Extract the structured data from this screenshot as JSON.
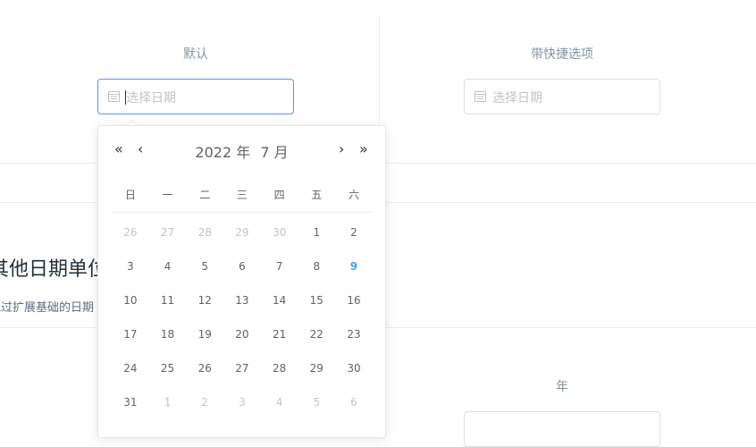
{
  "demos": {
    "default": {
      "label": "默认",
      "placeholder": "选择日期"
    },
    "shortcuts": {
      "label": "带快捷选项",
      "placeholder": "选择日期"
    },
    "year": {
      "label": "年"
    }
  },
  "section": {
    "title": "其他日期单位",
    "desc": "通过扩展基础的日期"
  },
  "picker": {
    "year_text": "2022 年",
    "month_text": "7 月",
    "nav": {
      "prev_year": "«",
      "prev_month": "‹",
      "next_month": "›",
      "next_year": "»"
    },
    "weekdays": [
      "日",
      "一",
      "二",
      "三",
      "四",
      "五",
      "六"
    ],
    "weeks": [
      [
        {
          "d": "26",
          "t": "other"
        },
        {
          "d": "27",
          "t": "other"
        },
        {
          "d": "28",
          "t": "other"
        },
        {
          "d": "29",
          "t": "other"
        },
        {
          "d": "30",
          "t": "other"
        },
        {
          "d": "1",
          "t": "cur"
        },
        {
          "d": "2",
          "t": "cur"
        }
      ],
      [
        {
          "d": "3",
          "t": "cur"
        },
        {
          "d": "4",
          "t": "cur"
        },
        {
          "d": "5",
          "t": "cur"
        },
        {
          "d": "6",
          "t": "cur"
        },
        {
          "d": "7",
          "t": "cur"
        },
        {
          "d": "8",
          "t": "cur"
        },
        {
          "d": "9",
          "t": "today"
        }
      ],
      [
        {
          "d": "10",
          "t": "cur"
        },
        {
          "d": "11",
          "t": "cur"
        },
        {
          "d": "12",
          "t": "cur"
        },
        {
          "d": "13",
          "t": "cur"
        },
        {
          "d": "14",
          "t": "cur"
        },
        {
          "d": "15",
          "t": "cur"
        },
        {
          "d": "16",
          "t": "cur"
        }
      ],
      [
        {
          "d": "17",
          "t": "cur"
        },
        {
          "d": "18",
          "t": "cur"
        },
        {
          "d": "19",
          "t": "cur"
        },
        {
          "d": "20",
          "t": "cur"
        },
        {
          "d": "21",
          "t": "cur"
        },
        {
          "d": "22",
          "t": "cur"
        },
        {
          "d": "23",
          "t": "cur"
        }
      ],
      [
        {
          "d": "24",
          "t": "cur"
        },
        {
          "d": "25",
          "t": "cur"
        },
        {
          "d": "26",
          "t": "cur"
        },
        {
          "d": "27",
          "t": "cur"
        },
        {
          "d": "28",
          "t": "cur"
        },
        {
          "d": "29",
          "t": "cur"
        },
        {
          "d": "30",
          "t": "cur"
        }
      ],
      [
        {
          "d": "31",
          "t": "cur"
        },
        {
          "d": "1",
          "t": "other"
        },
        {
          "d": "2",
          "t": "other"
        },
        {
          "d": "3",
          "t": "other"
        },
        {
          "d": "4",
          "t": "other"
        },
        {
          "d": "5",
          "t": "other"
        },
        {
          "d": "6",
          "t": "other"
        }
      ]
    ]
  },
  "colors": {
    "accent": "#409eff",
    "muted": "#c0c4cc",
    "text": "#606266"
  },
  "icons": {
    "input_prefix": "calendar-icon"
  }
}
